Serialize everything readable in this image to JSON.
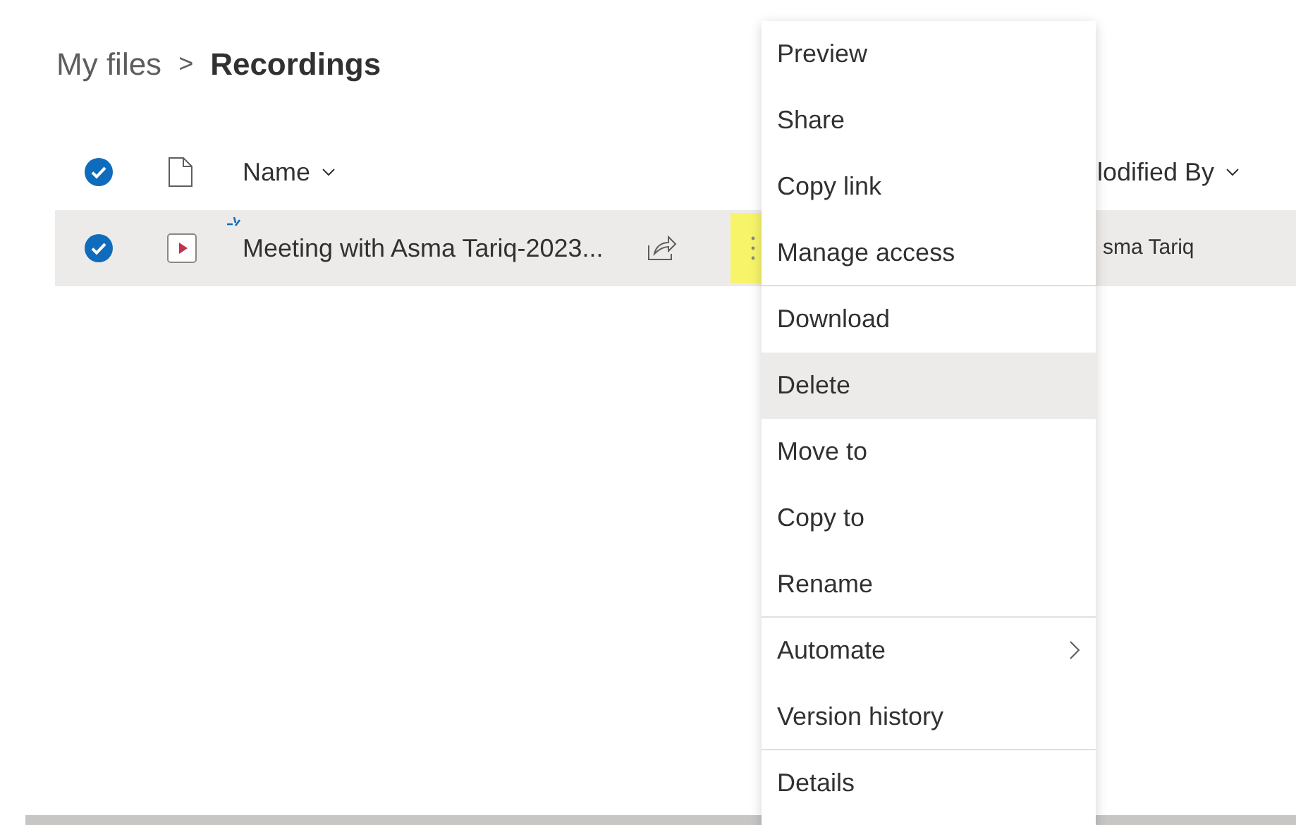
{
  "breadcrumb": {
    "parent": "My files",
    "separator": ">",
    "current": "Recordings"
  },
  "table": {
    "columns": [
      {
        "label": "Name",
        "sortable": true
      },
      {
        "label": "lodified By",
        "sortable": true
      }
    ],
    "rows": [
      {
        "name": "Meeting with Asma Tariq-2023...",
        "modified_by": "sma Tariq",
        "selected": true,
        "new": true
      }
    ]
  },
  "all_selected": true,
  "menu": {
    "items": [
      {
        "label": "Preview",
        "kind": "item",
        "selected": false,
        "divider_after": false
      },
      {
        "label": "Share",
        "kind": "item",
        "selected": false,
        "divider_after": false
      },
      {
        "label": "Copy link",
        "kind": "item",
        "selected": false,
        "divider_after": false
      },
      {
        "label": "Manage access",
        "kind": "item",
        "selected": false,
        "divider_after": true
      },
      {
        "label": "Download",
        "kind": "item",
        "selected": false,
        "divider_after": false
      },
      {
        "label": "Delete",
        "kind": "item",
        "selected": true,
        "divider_after": false
      },
      {
        "label": "Move to",
        "kind": "item",
        "selected": false,
        "divider_after": false
      },
      {
        "label": "Copy to",
        "kind": "item",
        "selected": false,
        "divider_after": false
      },
      {
        "label": "Rename",
        "kind": "item",
        "selected": false,
        "divider_after": true
      },
      {
        "label": "Automate",
        "kind": "submenu",
        "selected": false,
        "divider_after": false
      },
      {
        "label": "Version history",
        "kind": "item",
        "selected": false,
        "divider_after": true
      },
      {
        "label": "Details",
        "kind": "item",
        "selected": false,
        "divider_after": false
      }
    ]
  }
}
